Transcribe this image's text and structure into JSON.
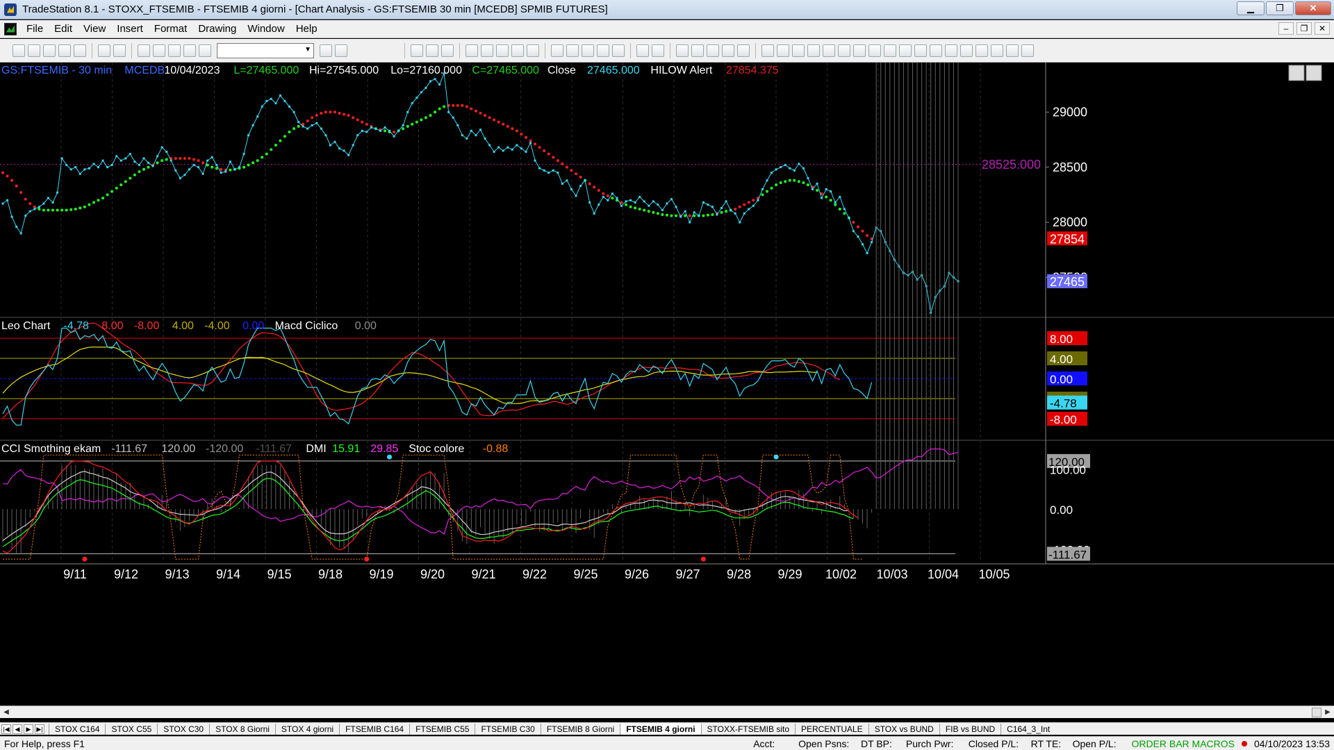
{
  "window": {
    "title": "TradeStation 8.1 - STOXX_FTSEMIB - FTSEMIB  4 giorni - [Chart Analysis - GS:FTSEMIB  30 min  [MCEDB] SPMIB FUTURES]",
    "min_icon": "minimize-icon",
    "max_icon": "maximize-icon",
    "close_icon": "close-icon"
  },
  "menu": [
    "File",
    "Edit",
    "View",
    "Insert",
    "Format",
    "Drawing",
    "Window",
    "Help"
  ],
  "chart_data": {
    "type": "line",
    "header": {
      "symbol": "GS:FTSEMIB - 30 min",
      "source": "MCEDB",
      "date": "10/04/2023",
      "L": "L=27465.000",
      "Hi": "Hi=27545.000",
      "Lo": "Lo=27160.000",
      "C": "C=27465.000",
      "close_label": "Close",
      "close_val": "27465.000",
      "alert_label": "HILOW Alert",
      "alert_val": "27854.375"
    },
    "x_labels": [
      "9/11",
      "9/12",
      "9/13",
      "9/14",
      "9/15",
      "9/18",
      "9/19",
      "9/20",
      "9/21",
      "9/22",
      "9/25",
      "9/26",
      "9/27",
      "9/28",
      "9/29",
      "10/02",
      "10/03",
      "10/04",
      "10/05"
    ],
    "price_axis": {
      "ticks": [
        29000,
        28500,
        28000,
        27500
      ],
      "min": 27150,
      "max": 29450
    },
    "price_marker_line": {
      "value": 28525,
      "label": "28525.000"
    },
    "last_badges": [
      {
        "label": "27854",
        "color": "#e00000",
        "value": 27854
      },
      {
        "label": "27465",
        "color": "#6a6aff",
        "value": 27465
      }
    ],
    "price_series": [
      {
        "name": "Close",
        "color": "#3ad6f0",
        "values": [
          28170,
          28200,
          28050,
          27960,
          27900,
          28060,
          28100,
          28120,
          28140,
          28170,
          28220,
          28180,
          28270,
          28580,
          28520,
          28480,
          28500,
          28440,
          28480,
          28490,
          28530,
          28500,
          28560,
          28500,
          28520,
          28600,
          28560,
          28580,
          28620,
          28550,
          28520,
          28580,
          28540,
          28510,
          28600,
          28680,
          28640,
          28560,
          28470,
          28400,
          28430,
          28480,
          28520,
          28500,
          28440,
          28560,
          28590,
          28520,
          28450,
          28460,
          28550,
          28480,
          28500,
          28620,
          28790,
          28880,
          28960,
          29050,
          29100,
          29120,
          29080,
          29150,
          29100,
          29050,
          29000,
          28910,
          28870,
          28850,
          28880,
          28900,
          28850,
          28790,
          28700,
          28730,
          28670,
          28650,
          28610,
          28700,
          28790,
          28830,
          28820,
          28860,
          28850,
          28830,
          28860,
          28830,
          28780,
          28830,
          28880,
          29000,
          29080,
          29130,
          29180,
          29220,
          29280,
          29300,
          29250,
          29350,
          29000,
          28950,
          28880,
          28790,
          28760,
          28830,
          28790,
          28840,
          28760,
          28700,
          28640,
          28680,
          28650,
          28680,
          28660,
          28700,
          28670,
          28640,
          28720,
          28560,
          28490,
          28470,
          28450,
          28470,
          28450,
          28350,
          28380,
          28300,
          28240,
          28330,
          28380,
          28180,
          28080,
          28160,
          28230,
          28200,
          28260,
          28220,
          28150,
          28190,
          28200,
          28180,
          28230,
          28190,
          28150,
          28190,
          28160,
          28110,
          28170,
          28210,
          28140,
          28050,
          28100,
          28000,
          28090,
          28060,
          28180,
          28160,
          28140,
          28070,
          28130,
          28190,
          28110,
          28080,
          28000,
          28080,
          28120,
          28150,
          28200,
          28300,
          28380,
          28450,
          28480,
          28500,
          28520,
          28490,
          28470,
          28530,
          28490,
          28400,
          28300,
          28350,
          28220,
          28300,
          28280,
          28180,
          28230,
          28120,
          28040,
          27920,
          27870,
          27800,
          27720,
          27820,
          27950,
          27920,
          27820,
          27740,
          27660,
          27600,
          27540,
          27520,
          27550,
          27480,
          27520,
          27420,
          27180,
          27320,
          27380,
          27420,
          27540,
          27500,
          27465
        ]
      },
      {
        "name": "MA",
        "color": "bicolor",
        "values": [
          28450,
          28420,
          28380,
          28330,
          28270,
          28210,
          28170,
          28140,
          28120,
          28110,
          28110,
          28110,
          28110,
          28110,
          28110,
          28115,
          28120,
          28130,
          28140,
          28160,
          28180,
          28200,
          28220,
          28250,
          28280,
          28310,
          28340,
          28370,
          28400,
          28430,
          28460,
          28480,
          28500,
          28520,
          28540,
          28560,
          28570,
          28580,
          28580,
          28580,
          28580,
          28580,
          28570,
          28560,
          28540,
          28520,
          28500,
          28490,
          28480,
          28475,
          28475,
          28480,
          28490,
          28500,
          28520,
          28540,
          28560,
          28590,
          28620,
          28660,
          28700,
          28740,
          28780,
          28820,
          28850,
          28870,
          28890,
          28920,
          28950,
          28970,
          28990,
          29000,
          29000,
          29000,
          28990,
          28980,
          28970,
          28950,
          28930,
          28910,
          28890,
          28870,
          28850,
          28840,
          28830,
          28820,
          28820,
          28830,
          28850,
          28870,
          28890,
          28910,
          28930,
          28950,
          28970,
          29000,
          29030,
          29050,
          29060,
          29060,
          29060,
          29060,
          29050,
          29030,
          29010,
          28990,
          28970,
          28950,
          28930,
          28910,
          28890,
          28870,
          28850,
          28830,
          28800,
          28770,
          28740,
          28710,
          28680,
          28650,
          28620,
          28590,
          28560,
          28530,
          28500,
          28470,
          28440,
          28410,
          28380,
          28350,
          28320,
          28290,
          28260,
          28240,
          28220,
          28200,
          28180,
          28160,
          28140,
          28130,
          28120,
          28110,
          28100,
          28090,
          28080,
          28070,
          28065,
          28060,
          28060,
          28060,
          28060,
          28060,
          28060,
          28060,
          28060,
          28065,
          28070,
          28080,
          28090,
          28100,
          28110,
          28120,
          28140,
          28160,
          28180,
          28200,
          28220,
          28250,
          28280,
          28310,
          28340,
          28360,
          28370,
          28380,
          28380,
          28370,
          28360,
          28340,
          28320,
          28290,
          28260,
          28230,
          28200,
          28160,
          28120,
          28080,
          28040,
          28000,
          27960,
          27920,
          27880,
          27850
        ]
      }
    ],
    "oscillator1": {
      "label": "Leo Chart",
      "v1": "-4.78",
      "v2": "8.00",
      "v3": "-8.00",
      "v4": "4.00",
      "v5": "-4.00",
      "v6": "0.00",
      "label2": "Macd Ciclico",
      "v7": "0.00",
      "levels": [
        {
          "value": 8,
          "color": "#e00000",
          "label": "8.00",
          "badge": "#e00000"
        },
        {
          "value": 4,
          "color": "#b0b000",
          "label": "4.00",
          "badge": "#6a6a00"
        },
        {
          "value": 0,
          "color": "#1010ff",
          "label": "0.00",
          "badge": "#1010ff"
        },
        {
          "value": -4,
          "color": "#b0b000",
          "label": "-4.00",
          "badge": "#6a6a00"
        },
        {
          "value": -8,
          "color": "#e00000",
          "label": "-8.00",
          "badge": "#e00000"
        }
      ],
      "current": {
        "label": "-4.78",
        "value": -4.78
      }
    },
    "oscillator2": {
      "label": "CCI Smothing ekam",
      "v1": "-111.67",
      "v2": "120.00",
      "v3": "-120.00",
      "v4": "-111.67",
      "label2": "DMI",
      "v5": "15.91",
      "v6": "29.85",
      "label3": "Stoc colore",
      "v7": "-0.88",
      "axis": [
        {
          "label": "120.00",
          "value": 120
        },
        {
          "label": "100.00",
          "value": 100
        },
        {
          "label": "0.00",
          "value": 0
        },
        {
          "label": "-100.00",
          "value": -100
        },
        {
          "label": "-111.67",
          "value": -111.67
        }
      ]
    },
    "colors": {
      "bg": "#000000",
      "cyan": "#3ad6f0",
      "red": "#ff2020",
      "green": "#20ff20",
      "yellow": "#e8e000",
      "magenta": "#e020e0",
      "orange": "#ff8000",
      "grid": "#2a2a2a"
    }
  },
  "tabs": [
    "STOX C164",
    "STOX C55",
    "STOX  C30",
    "STOX  8 Giorni",
    "STOX 4 giorni",
    "FTSEMIB C164",
    "FTSEMIB C55",
    "FTSEMIB C30",
    "FTSEMIB  8 Giorni",
    "FTSEMIB  4 giorni",
    "STOXX-FTSEMIB sito",
    "PERCENTUALE",
    "STOX vs BUND",
    "FIB vs BUND",
    "C164_3_Int"
  ],
  "active_tab": "FTSEMIB  4 giorni",
  "status": {
    "help": "For Help, press F1",
    "acct": "Acct:",
    "open_psns": "Open Psns:",
    "dt_bp": "DT BP:",
    "purch_pwr": "Purch Pwr:",
    "closed_pl": "Closed P/L:",
    "rt_te": "RT TE:",
    "open_pl": "Open P/L:",
    "macros": "ORDER BAR  MACROS",
    "datetime": "04/10/2023 13:53"
  }
}
